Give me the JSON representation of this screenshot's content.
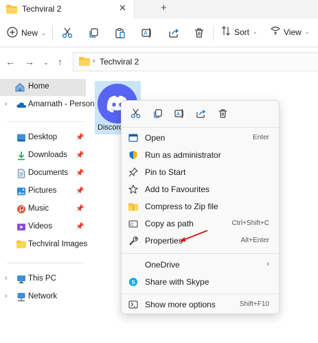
{
  "window": {
    "tab_title": "Techviral 2",
    "close_glyph": "✕",
    "new_tab_glyph": "+"
  },
  "toolbar": {
    "new_label": "New",
    "sort_label": "Sort",
    "view_label": "View",
    "icons": [
      "cut-icon",
      "copy-icon",
      "paste-icon",
      "rename-icon",
      "share-icon",
      "delete-icon"
    ]
  },
  "address": {
    "crumb": "Techviral 2",
    "separator": "›"
  },
  "sidebar": {
    "home": "Home",
    "cloud": "Amarnath - Person",
    "quick_access": [
      {
        "label": "Desktop",
        "icon": "desktop-icon"
      },
      {
        "label": "Downloads",
        "icon": "download-icon"
      },
      {
        "label": "Documents",
        "icon": "documents-icon"
      },
      {
        "label": "Pictures",
        "icon": "pictures-icon"
      },
      {
        "label": "Music",
        "icon": "music-icon"
      },
      {
        "label": "Videos",
        "icon": "videos-icon"
      },
      {
        "label": "Techviral Images",
        "icon": "folder-icon"
      }
    ],
    "this_pc": "This PC",
    "network": "Network"
  },
  "file": {
    "name": "Discord"
  },
  "context_menu": {
    "items": [
      {
        "label": "Open",
        "shortcut": "Enter"
      },
      {
        "label": "Run as administrator",
        "shortcut": ""
      },
      {
        "label": "Pin to Start",
        "shortcut": ""
      },
      {
        "label": "Add to Favourites",
        "shortcut": ""
      },
      {
        "label": "Compress to Zip file",
        "shortcut": ""
      },
      {
        "label": "Copy as path",
        "shortcut": "Ctrl+Shift+C"
      },
      {
        "label": "Properties",
        "shortcut": "Alt+Enter"
      },
      {
        "label": "OneDrive",
        "shortcut": ""
      },
      {
        "label": "Share with Skype",
        "shortcut": ""
      },
      {
        "label": "Show more options",
        "shortcut": "Shift+F10"
      }
    ]
  },
  "colors": {
    "accent": "#0067c0",
    "discord": "#5865f2",
    "selection": "#cce4f7",
    "folder": "#f8c23a",
    "annotation": "#d11a1a"
  }
}
